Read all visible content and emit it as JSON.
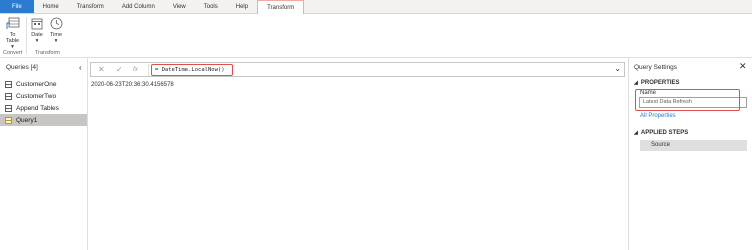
{
  "tabs": [
    {
      "label": "File"
    },
    {
      "label": "Home"
    },
    {
      "label": "Transform"
    },
    {
      "label": "Add Column"
    },
    {
      "label": "View"
    },
    {
      "label": "Tools"
    },
    {
      "label": "Help"
    },
    {
      "label": "Transform"
    }
  ],
  "ribbon": {
    "to_table_label_1": "To",
    "to_table_label_2": "Table",
    "date_label": "Date",
    "time_label": "Time",
    "group_convert": "Convert",
    "group_transform": "Transform"
  },
  "queries": {
    "header": "Queries [4]",
    "items": [
      {
        "label": "CustomerOne"
      },
      {
        "label": "CustomerTwo"
      },
      {
        "label": "Append Tables"
      },
      {
        "label": "Query1"
      }
    ]
  },
  "formula_bar": {
    "formula": "= DateTime.LocalNow()"
  },
  "result": {
    "value": "2020-06-23T20:36:30.4156578"
  },
  "query_settings": {
    "title": "Query Settings",
    "properties_header": "PROPERTIES",
    "name_label": "Name",
    "name_value": "Latest Data Refresh",
    "all_properties": "All Properties",
    "applied_steps_header": "APPLIED STEPS",
    "steps": [
      {
        "label": "Source"
      }
    ]
  },
  "colors": {
    "accent": "#2b7bd1",
    "highlight": "#e0504b",
    "selected": "#c8c6c4"
  }
}
